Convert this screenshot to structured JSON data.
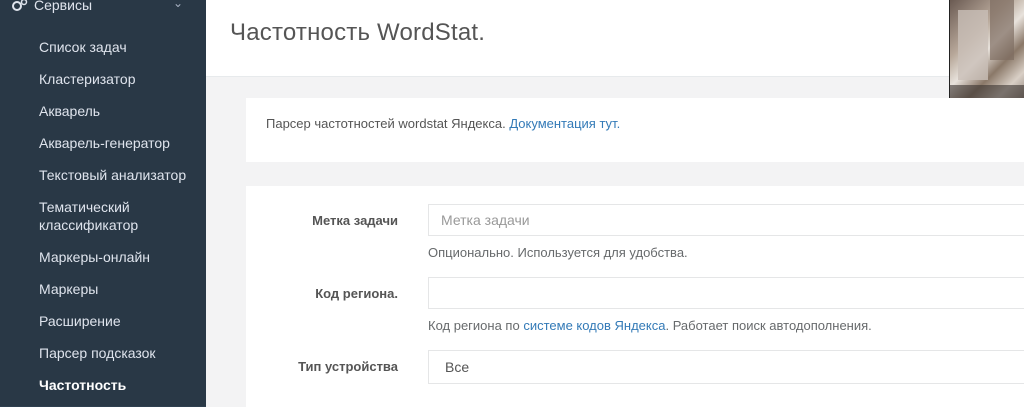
{
  "sidebar": {
    "section_title": "Сервисы",
    "items": [
      {
        "label": "Список задач"
      },
      {
        "label": "Кластеризатор"
      },
      {
        "label": "Акварель"
      },
      {
        "label": "Акварель-генератор"
      },
      {
        "label": "Текстовый анализатор"
      },
      {
        "label": "Тематический классификатор"
      },
      {
        "label": "Маркеры-онлайн"
      },
      {
        "label": "Маркеры"
      },
      {
        "label": "Расширение"
      },
      {
        "label": "Парсер подсказок"
      },
      {
        "label": "Частотность"
      }
    ],
    "active_item": "Частотность"
  },
  "header": {
    "title": "Частотность WordStat."
  },
  "info": {
    "text": "Парсер частотностей wordstat Яндекса.",
    "link_text": "Документация тут."
  },
  "form": {
    "task_label": {
      "label": "Метка задачи",
      "placeholder": "Метка задачи",
      "value": "",
      "help": "Опционально. Используется для удобства."
    },
    "region_code": {
      "label": "Код региона.",
      "value": "",
      "help_before": "Код региона по",
      "help_link": "системе кодов Яндекса",
      "help_after": ". Работает поиск автодополнения."
    },
    "device_type": {
      "label": "Тип устройства",
      "value": "Все"
    }
  },
  "colors": {
    "sidebar_bg": "#2f4050",
    "link": "#337ab7"
  }
}
